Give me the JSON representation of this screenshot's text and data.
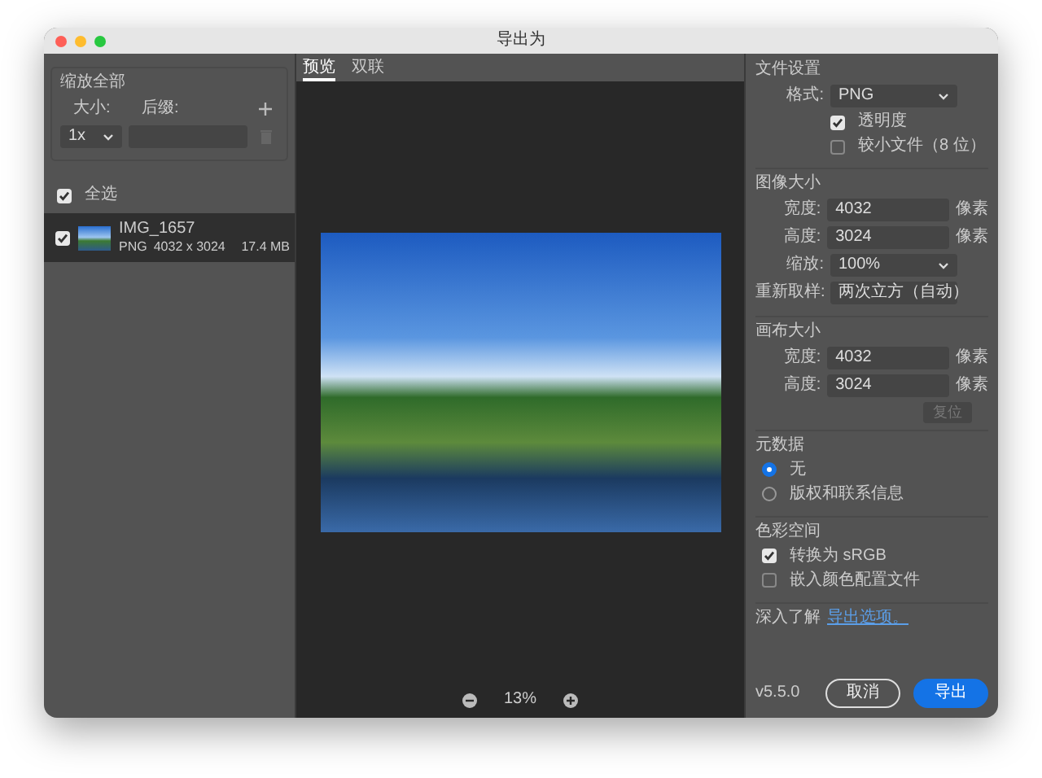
{
  "window": {
    "title": "导出为"
  },
  "scale_all": {
    "title": "缩放全部",
    "size_label": "大小:",
    "suffix_label": "后缀:",
    "size_value": "1x"
  },
  "select_all": {
    "label": "全选",
    "checked": true
  },
  "files": [
    {
      "name": "IMG_1657",
      "format": "PNG",
      "dimensions": "4032 x 3024",
      "size": "17.4 MB",
      "checked": true,
      "selected": true
    }
  ],
  "tabs": [
    {
      "label": "预览",
      "selected": true
    },
    {
      "label": "双联",
      "selected": false
    }
  ],
  "zoom": {
    "value": "13%"
  },
  "file_settings": {
    "title": "文件设置",
    "format_label": "格式:",
    "format": "PNG",
    "options": [
      {
        "label": "透明度",
        "checked": true
      },
      {
        "label": "较小文件（8 位）",
        "checked": false
      }
    ]
  },
  "image_size": {
    "title": "图像大小",
    "fields": [
      {
        "kind": "input",
        "label": "宽度:",
        "value": "4032",
        "unit": "像素"
      },
      {
        "kind": "input",
        "label": "高度:",
        "value": "3024",
        "unit": "像素"
      },
      {
        "kind": "select",
        "label": "缩放:",
        "value": "100%"
      },
      {
        "kind": "select",
        "label": "重新取样:",
        "value": "两次立方（自动）"
      }
    ]
  },
  "canvas_size": {
    "title": "画布大小",
    "fields": [
      {
        "kind": "input",
        "label": "宽度:",
        "value": "4032",
        "unit": "像素"
      },
      {
        "kind": "input",
        "label": "高度:",
        "value": "3024",
        "unit": "像素"
      }
    ],
    "reset_button": {
      "label": "复位",
      "disabled": true
    }
  },
  "metadata": {
    "title": "元数据",
    "options": [
      {
        "label": "无",
        "selected": true
      },
      {
        "label": "版权和联系信息",
        "selected": false
      }
    ]
  },
  "color_space": {
    "title": "色彩空间",
    "options": [
      {
        "label": "转换为 sRGB",
        "checked": true
      },
      {
        "label": "嵌入颜色配置文件",
        "checked": false
      }
    ]
  },
  "learn_more": {
    "text": "深入了解",
    "link": "导出选项。"
  },
  "version": "v5.5.0",
  "buttons": [
    {
      "label": "取消",
      "kind": "secondary"
    },
    {
      "label": "导出",
      "kind": "primary"
    }
  ]
}
